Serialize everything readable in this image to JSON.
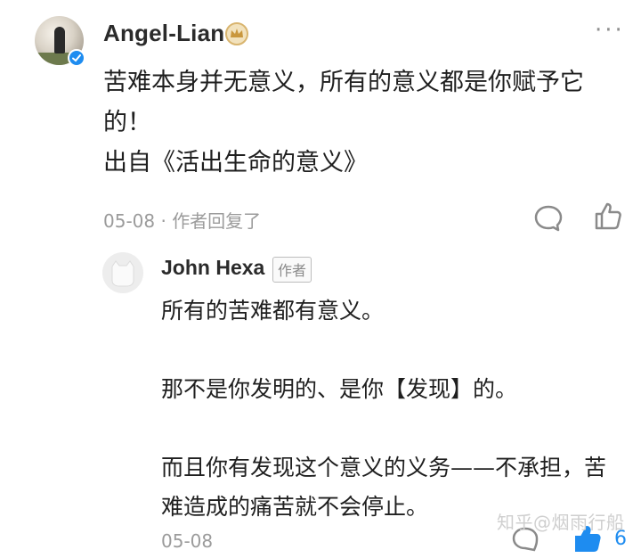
{
  "comment": {
    "author": "Angel-Lian",
    "text": "苦难本身并无意义，所有的意义都是你赋予它\n的！\n出自《活出生命的意义》",
    "meta": "05-08 · 作者回复了",
    "icons": [
      "more-icon",
      "reply-icon",
      "like-icon",
      "crown-badge-icon",
      "verified-icon"
    ]
  },
  "reply": {
    "author": "John Hexa",
    "author_tag": "作者",
    "text": "所有的苦难都有意义。\n\n那不是你发明的、是你【发现】的。\n\n而且你有发现这个意义的义务——不承担，苦\n难造成的痛苦就不会停止。",
    "date": "05-08",
    "like_count": "6"
  },
  "watermark": "知乎@烟雨行船",
  "colors": {
    "accent_blue": "#1e8cf0",
    "muted": "#9b9b9b",
    "gold": "#d9b56f"
  }
}
